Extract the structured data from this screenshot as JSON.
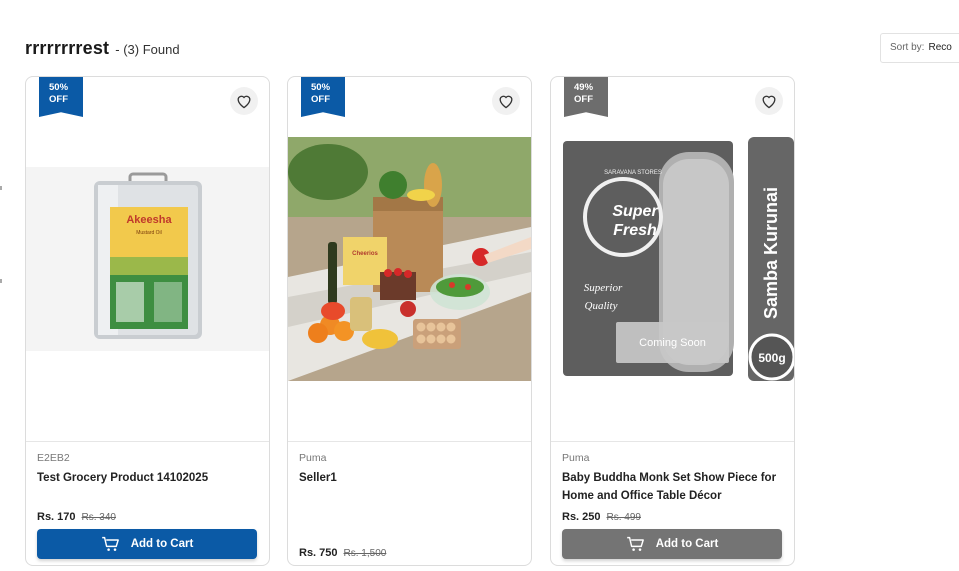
{
  "search": {
    "query": "rrrrrrrrest",
    "found_text": "- (3) Found"
  },
  "sort": {
    "label": "Sort by:",
    "value": "Reco"
  },
  "products": [
    {
      "badge_percent": "50%",
      "badge_off": "OFF",
      "brand": "E2EB2",
      "name": "Test Grocery Product 14102025",
      "price": "Rs. 170",
      "old_price": "Rs. 340",
      "cart_label": "Add to Cart",
      "image_label": "Akeesha",
      "image_sub": "Mustard Oil",
      "available": true
    },
    {
      "badge_percent": "50%",
      "badge_off": "OFF",
      "brand": "Puma",
      "name": "Seller1",
      "price": "Rs. 750",
      "old_price": "Rs. 1,500",
      "image_label": "Cheerios",
      "available": true
    },
    {
      "badge_percent": "49%",
      "badge_off": "OFF",
      "brand": "Puma",
      "name": "Baby Buddha Monk Set Show Piece for Home and Office Table Décor",
      "price": "Rs. 250",
      "old_price": "Rs. 499",
      "cart_label": "Add to Cart",
      "coming_soon": "Coming Soon",
      "image_store": "SARAVANA STORES",
      "image_brand_1": "Super",
      "image_brand_2": "Fresh",
      "image_tag_1": "Superior",
      "image_tag_2": "Quality",
      "image_product": "Samba Kurunai",
      "image_weight": "500g",
      "available": false
    }
  ],
  "colors": {
    "primary": "#0b5aa6",
    "disabled": "#747474"
  }
}
